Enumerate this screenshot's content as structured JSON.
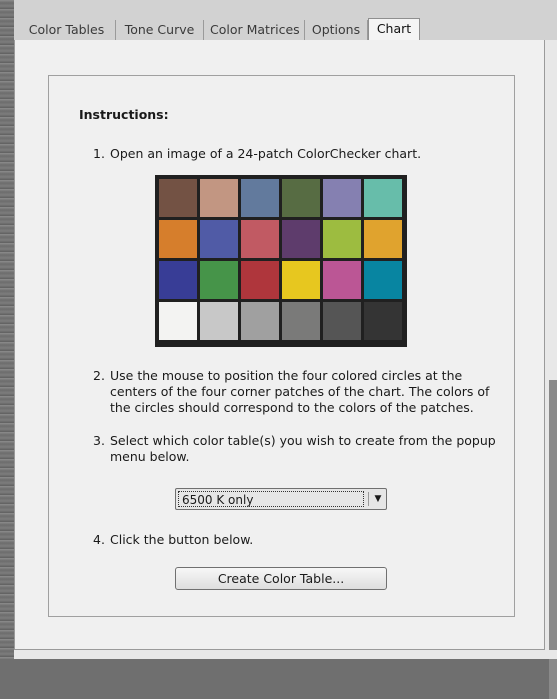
{
  "tabs": [
    {
      "label": "Color Tables"
    },
    {
      "label": "Tone Curve"
    },
    {
      "label": "Color Matrices"
    },
    {
      "label": "Options"
    },
    {
      "label": "Chart"
    }
  ],
  "active_tab": "Chart",
  "instructions": {
    "heading": "Instructions:",
    "step1": {
      "num": "1.",
      "text": "Open an image of a 24-patch ColorChecker chart."
    },
    "step2": {
      "num": "2.",
      "lines": [
        "Use the mouse to position the four colored circles at the",
        "centers of the four corner patches of the chart. The colors of",
        "the circles should correspond to the colors of the patches."
      ]
    },
    "step3": {
      "num": "3.",
      "lines": [
        "Select which color table(s) you wish to create from the popup",
        "menu below."
      ]
    },
    "step4": {
      "num": "4.",
      "text": "Click the button below."
    }
  },
  "colorchecker_patches": [
    [
      "#735244",
      "#c29682",
      "#627a9d",
      "#576c43",
      "#8580b1",
      "#67bdaa"
    ],
    [
      "#d67e2c",
      "#505ba6",
      "#c15a63",
      "#5e3c6c",
      "#9dbc40",
      "#e0a32e"
    ],
    [
      "#383d96",
      "#469449",
      "#af363c",
      "#e7c71f",
      "#bb5695",
      "#0885a1"
    ],
    [
      "#f3f3f2",
      "#c8c8c8",
      "#a0a0a0",
      "#7a7a79",
      "#555555",
      "#343434"
    ]
  ],
  "color_table_select": {
    "value": "6500 K only"
  },
  "create_button": {
    "label": "Create Color Table..."
  }
}
